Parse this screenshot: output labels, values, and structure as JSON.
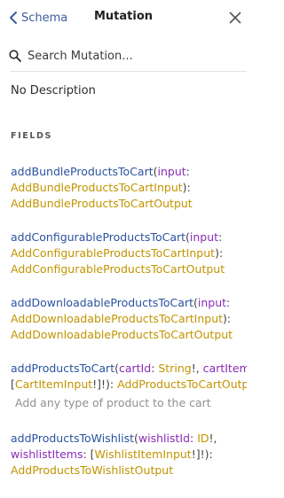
{
  "header": {
    "back_label": "Schema",
    "title": "Mutation"
  },
  "search": {
    "placeholder": "Search Mutation..."
  },
  "description": "No Description",
  "section_label": "FIELDS",
  "fields": [
    {
      "name": "addBundleProductsToCart",
      "args": [
        {
          "name": "input",
          "type": "AddBundleProductsToCartInput"
        }
      ],
      "return_type": "AddBundleProductsToCartOutput"
    },
    {
      "name": "addConfigurableProductsToCart",
      "args": [
        {
          "name": "input",
          "type": "AddConfigurableProductsToCartInput"
        }
      ],
      "return_type": "AddConfigurableProductsToCartOutput"
    },
    {
      "name": "addDownloadableProductsToCart",
      "args": [
        {
          "name": "input",
          "type": "AddDownloadableProductsToCartInput"
        }
      ],
      "return_type": "AddDownloadableProductsToCartOutput"
    },
    {
      "name": "addProductsToCart",
      "args": [
        {
          "name": "cartId",
          "type": "String"
        },
        {
          "name": "cartItems",
          "type": "CartItemInput"
        }
      ],
      "return_type": "AddProductsToCartOutput",
      "description": "Add any type of product to the cart"
    },
    {
      "name": "addProductsToWishlist",
      "args": [
        {
          "name": "wishlistId",
          "type": "ID"
        },
        {
          "name": "wishlistItems",
          "type": "WishlistItemInput"
        }
      ],
      "return_type": "AddProductsToWishlistOutput"
    }
  ]
}
